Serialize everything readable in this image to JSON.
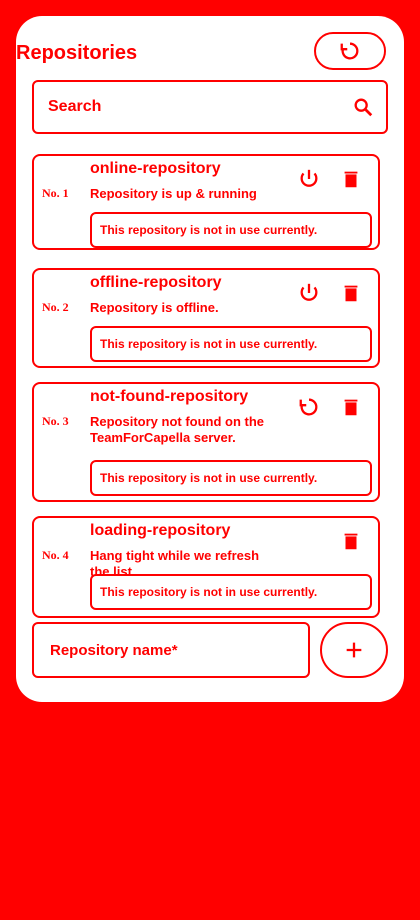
{
  "header": {
    "title": "Repositories",
    "refresh_label": ""
  },
  "search": {
    "placeholder": "Search"
  },
  "repos": [
    {
      "index": "No. 1",
      "name": "online-repository",
      "status": "Repository is up & running",
      "note": "This repository is not in use currently."
    },
    {
      "index": "No. 2",
      "name": "offline-repository",
      "status": "Repository is offline.",
      "note": "This repository is not in use currently."
    },
    {
      "index": "No. 3",
      "name": "not-found-repository",
      "status": "Repository not found on the TeamForCapella server.",
      "note": "This repository is not in use currently."
    },
    {
      "index": "No. 4",
      "name": "loading-repository",
      "status": "Hang tight while we refresh the list.",
      "note": "This repository is not in use currently."
    }
  ],
  "new_repo": {
    "placeholder": "Repository name*"
  },
  "colors": {
    "accent": "#ff0000",
    "background": "#ffffff"
  },
  "icons": [
    "refresh-icon",
    "search-icon",
    "power-icon",
    "delete-icon",
    "add-icon"
  ]
}
